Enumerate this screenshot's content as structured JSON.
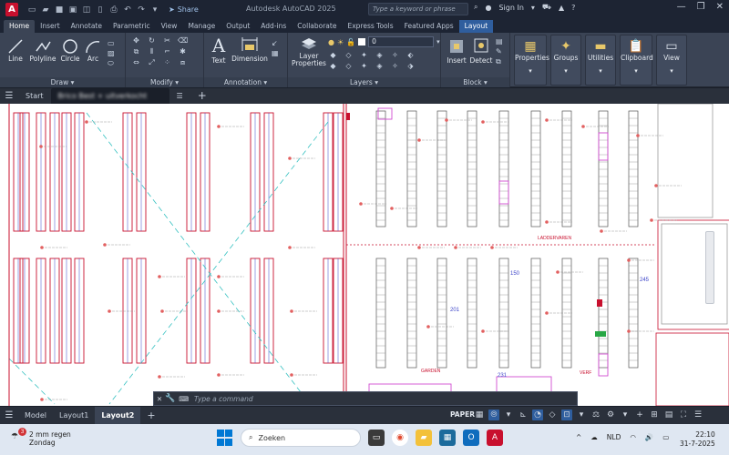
{
  "titlebar": {
    "app_letter": "A",
    "share_label": "Share",
    "title": "Autodesk AutoCAD 2025",
    "search_placeholder": "Type a keyword or phrase",
    "signin_label": "Sign In"
  },
  "ribbon_tabs": [
    "Home",
    "Insert",
    "Annotate",
    "Parametric",
    "View",
    "Manage",
    "Output",
    "Add-ins",
    "Collaborate",
    "Express Tools",
    "Featured Apps",
    "Layout"
  ],
  "ribbon": {
    "draw": {
      "label": "Draw",
      "line": "Line",
      "polyline": "Polyline",
      "circle": "Circle",
      "arc": "Arc"
    },
    "modify": {
      "label": "Modify"
    },
    "annotation": {
      "label": "Annotation",
      "text": "Text",
      "dimension": "Dimension"
    },
    "layers": {
      "label": "Layers",
      "layer_properties": "Layer Properties",
      "current_layer": "0"
    },
    "block": {
      "label": "Block",
      "insert": "Insert",
      "detect": "Detect"
    },
    "properties": "Properties",
    "groups": "Groups",
    "utilities": "Utilities",
    "clipboard": "Clipboard",
    "view": "View"
  },
  "filetabs": {
    "start": "Start",
    "active_file": "Brico Best + uitverkocht"
  },
  "drawing": {
    "labels": {
      "laddervaren": "LADDERVAREN",
      "garden": "GARDEN",
      "verf": "VERF",
      "shelf_150": "150",
      "shelf_201": "201",
      "shelf_245": "245",
      "shelf_231": "231"
    },
    "accent_line_color": "#c8102e",
    "dashed_line_color": "#35c1c1"
  },
  "command": {
    "placeholder": "Type a command"
  },
  "layout_tabs": [
    "Model",
    "Layout1",
    "Layout2"
  ],
  "active_layout_tab": "Layout2",
  "status": {
    "paper": "PAPER"
  },
  "taskbar": {
    "weather_badge": "3",
    "weather_line1": "2 mm regen",
    "weather_line2": "Zondag",
    "search_label": "Zoeken",
    "language": "NLD",
    "time": "22:10",
    "date": "31-7-2025"
  }
}
